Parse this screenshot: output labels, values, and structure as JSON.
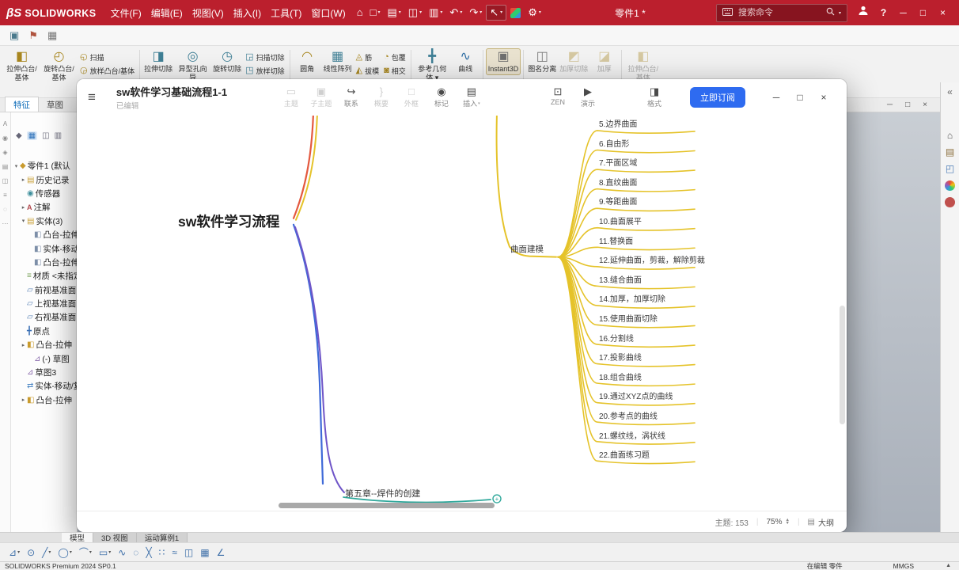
{
  "colors": {
    "solidworks_red": "#bb1f2d",
    "xmind_blue": "#2e6bf0"
  },
  "solidworks": {
    "titlebar": {
      "logo": "SOLIDWORKS",
      "menus": [
        "文件(F)",
        "编辑(E)",
        "视图(V)",
        "插入(I)",
        "工具(T)",
        "窗口(W)"
      ],
      "tools": [
        {
          "name": "home-icon",
          "glyph": "⌂"
        },
        {
          "name": "new-file-icon",
          "glyph": "□",
          "caret": true
        },
        {
          "name": "open-file-icon",
          "glyph": "▤",
          "caret": true
        },
        {
          "name": "save-icon",
          "glyph": "◫",
          "caret": true
        },
        {
          "name": "print-icon",
          "glyph": "▥",
          "caret": true
        },
        {
          "name": "undo-icon",
          "glyph": "↶",
          "caret": true
        },
        {
          "name": "redo-icon",
          "glyph": "↷",
          "caret": true
        },
        {
          "name": "select-cursor-icon",
          "glyph": "↖",
          "caret": true,
          "boxed": true
        },
        {
          "name": "xpress-products-icon",
          "cube": true
        },
        {
          "name": "options-icon",
          "glyph": "⚙",
          "caret": true
        }
      ],
      "doc_title": "零件1 *",
      "search_placeholder": "搜索命令"
    },
    "quickbar": [
      {
        "name": "capture-icon",
        "glyph": "▣",
        "color": "#49798c"
      },
      {
        "name": "flag-icon",
        "glyph": "⚑",
        "color": "#b0543f"
      },
      {
        "name": "grid-icon",
        "glyph": "▦",
        "color": "#767676"
      }
    ],
    "ribbon": [
      {
        "t": "big",
        "id": "extruded-boss",
        "label": "拉伸凸台/基体",
        "glyph": "◧"
      },
      {
        "t": "big",
        "id": "revolved-boss",
        "label": "旋转凸台/基体",
        "glyph": "◴"
      },
      {
        "t": "col",
        "items": [
          {
            "id": "swept-boss",
            "label": "扫描",
            "glyph": "◵"
          },
          {
            "id": "lofted-boss",
            "label": "放样凸台/基体",
            "glyph": "◶"
          }
        ]
      },
      {
        "t": "sep"
      },
      {
        "t": "big",
        "id": "extruded-cut",
        "label": "拉伸切除",
        "glyph": "◨",
        "c": "#3f7f95"
      },
      {
        "t": "big",
        "id": "hole-wizard",
        "label": "异型孔向导",
        "glyph": "◎",
        "c": "#3f7f95"
      },
      {
        "t": "big",
        "id": "revolved-cut",
        "label": "旋转切除",
        "glyph": "◷",
        "c": "#3f7f95"
      },
      {
        "t": "col",
        "items": [
          {
            "id": "swept-cut",
            "label": "扫描切除",
            "glyph": "◲",
            "c": "#3f7f95"
          },
          {
            "id": "lofted-cut",
            "label": "放样切除",
            "glyph": "◳",
            "c": "#3f7f95"
          }
        ]
      },
      {
        "t": "sep"
      },
      {
        "t": "big",
        "id": "fillet",
        "label": "圆角",
        "glyph": "◠"
      },
      {
        "t": "big",
        "id": "linear-pattern",
        "label": "线性阵列",
        "glyph": "▦",
        "c": "#3f7f95"
      },
      {
        "t": "col",
        "items": [
          {
            "id": "rib",
            "label": "筋",
            "glyph": "◬"
          },
          {
            "id": "draft",
            "label": "拔模",
            "glyph": "◭"
          }
        ]
      },
      {
        "t": "col",
        "items": [
          {
            "id": "wrap",
            "label": "包覆",
            "glyph": "◔"
          },
          {
            "id": "intersect",
            "label": "相交",
            "glyph": "◙"
          }
        ]
      },
      {
        "t": "sep"
      },
      {
        "t": "big",
        "id": "reference-geometry",
        "label": "参考几何体",
        "glyph": "╋",
        "c": "#3f7f95",
        "caret": true
      },
      {
        "t": "big",
        "id": "curves",
        "label": "曲线",
        "glyph": "∿",
        "c": "#2e6da3"
      },
      {
        "t": "sep"
      },
      {
        "t": "big",
        "id": "instant3d",
        "label": "Instant3D",
        "glyph": "▣",
        "c": "#6f6f6f",
        "active": true
      },
      {
        "t": "sep"
      },
      {
        "t": "big",
        "id": "detach",
        "label": "图名分离",
        "glyph": "◫",
        "c": "#7a7a7a"
      },
      {
        "t": "big",
        "id": "thicken-cut",
        "label": "加厚切除",
        "glyph": "◩",
        "disabled": true
      },
      {
        "t": "big",
        "id": "thicken",
        "label": "加厚",
        "glyph": "◪",
        "disabled": true
      },
      {
        "t": "sep"
      },
      {
        "t": "big",
        "id": "extruded-boss-2",
        "label": "拉伸凸台/基体",
        "glyph": "◧",
        "disabled": true
      }
    ],
    "cmd_tabs": [
      {
        "label": "特征",
        "active": true
      },
      {
        "label": "草图"
      }
    ],
    "left_strip_icons": [
      {
        "name": "annotation-a-icon",
        "glyph": "A"
      },
      {
        "name": "eye-icon",
        "glyph": "◉"
      },
      {
        "name": "diamond-icon",
        "glyph": "◈"
      },
      {
        "name": "layers-icon",
        "glyph": "▤"
      },
      {
        "name": "panel-icon",
        "glyph": "◫"
      },
      {
        "name": "list-icon",
        "glyph": "≡"
      },
      {
        "name": "circle-icon",
        "glyph": "◌"
      },
      {
        "name": "dots-icon",
        "glyph": "⋯"
      }
    ],
    "tree": {
      "toolbar": [
        {
          "name": "featuremanager-tab-icon",
          "glyph": "◆"
        },
        {
          "name": "propertymanager-tab-icon",
          "glyph": "▦",
          "active": true
        },
        {
          "name": "configuration-tab-icon",
          "glyph": "◫"
        },
        {
          "name": "display-tab-icon",
          "glyph": "▥"
        }
      ],
      "rows": [
        {
          "id": "part",
          "d": 0,
          "exp": "▾",
          "icon": "part",
          "label": "零件1 (默认"
        },
        {
          "id": "history",
          "d": 1,
          "exp": "▸",
          "icon": "folder",
          "label": "历史记录"
        },
        {
          "id": "sensors",
          "d": 1,
          "icon": "sensor",
          "label": "传感器"
        },
        {
          "id": "annotations",
          "d": 1,
          "exp": "▸",
          "icon": "ann",
          "label": "注解"
        },
        {
          "id": "solid-bodies",
          "d": 1,
          "exp": "▾",
          "icon": "folder",
          "label": "实体(3)"
        },
        {
          "id": "body-1",
          "d": 2,
          "icon": "body",
          "label": "凸台-拉伸"
        },
        {
          "id": "body-2",
          "d": 2,
          "icon": "body",
          "label": "实体-移动"
        },
        {
          "id": "body-3",
          "d": 2,
          "icon": "body",
          "label": "凸台-拉伸"
        },
        {
          "id": "material",
          "d": 1,
          "icon": "mat",
          "label": "材质 <未指定>"
        },
        {
          "id": "front-plane",
          "d": 1,
          "icon": "plane",
          "label": "前视基准面"
        },
        {
          "id": "top-plane",
          "d": 1,
          "icon": "plane",
          "label": "上视基准面"
        },
        {
          "id": "right-plane",
          "d": 1,
          "icon": "plane",
          "label": "右视基准面"
        },
        {
          "id": "origin",
          "d": 1,
          "icon": "origin",
          "label": "原点"
        },
        {
          "id": "boss-extrude-1",
          "d": 1,
          "exp": "▸",
          "icon": "boss",
          "label": "凸台-拉伸"
        },
        {
          "id": "sketch-2",
          "d": 2,
          "icon": "sketch",
          "label": "(-) 草图"
        },
        {
          "id": "sketch-3",
          "d": 1,
          "icon": "sketch",
          "label": "草图3"
        },
        {
          "id": "body-move-copy",
          "d": 1,
          "icon": "move",
          "label": "实体-移动/复制"
        },
        {
          "id": "boss-extrude-2",
          "d": 1,
          "exp": "▸",
          "icon": "boss",
          "label": "凸台-拉伸"
        }
      ]
    },
    "task_pane": [
      {
        "name": "collapse-chevron-icon",
        "glyph": "«",
        "color": "#666666"
      },
      {
        "name": "resources-home-icon",
        "glyph": "⌂",
        "color": "#555555",
        "gap": 34
      },
      {
        "name": "design-library-icon",
        "glyph": "▤",
        "color": "#8a6d3b"
      },
      {
        "name": "file-explorer-icon",
        "glyph": "◰",
        "color": "#4a7ab5"
      },
      {
        "name": "appearances-icon",
        "circle": "conic"
      },
      {
        "name": "scenes-icon",
        "circle": "#c0504d"
      }
    ],
    "bottom_tabs": [
      {
        "label": "模型",
        "active": true
      },
      {
        "label": "3D 视图"
      },
      {
        "label": "运动算例1"
      }
    ],
    "sketch_tools": [
      {
        "name": "sketch-icon",
        "glyph": "⊿",
        "caret": true
      },
      {
        "name": "smart-dimension-icon",
        "glyph": "⊙"
      },
      {
        "name": "line-icon",
        "glyph": "╱",
        "caret": true
      },
      {
        "name": "circle-icon",
        "glyph": "◯",
        "caret": true
      },
      {
        "name": "arc-icon",
        "glyph": "⌒",
        "caret": true
      },
      {
        "name": "rectangle-icon",
        "glyph": "▭",
        "caret": true
      },
      {
        "name": "spline-icon",
        "glyph": "∿"
      },
      {
        "name": "ellipse-icon",
        "glyph": "◌"
      },
      {
        "name": "trim-icon",
        "glyph": "╳"
      },
      {
        "name": "convert-entities-icon",
        "glyph": "∷"
      },
      {
        "name": "offset-icon",
        "glyph": "≈"
      },
      {
        "name": "mirror-icon",
        "glyph": "◫"
      },
      {
        "name": "pattern-icon",
        "glyph": "▦"
      },
      {
        "name": "angle-icon",
        "glyph": "∠"
      }
    ],
    "statusbar": {
      "left": "SOLIDWORKS Premium 2024 SP0.1",
      "editing": "在编辑 零件",
      "units": "MMGS"
    }
  },
  "xmind": {
    "title": "sw软件学习基础流程1-1",
    "subtitle": "已编辑",
    "tools": [
      {
        "id": "topic",
        "label": "主题",
        "icon": "▭",
        "disabled": true
      },
      {
        "id": "subtopic",
        "label": "子主题",
        "icon": "▣",
        "disabled": true
      },
      {
        "id": "relationship",
        "label": "联系",
        "icon": "↪"
      },
      {
        "id": "summary",
        "label": "概要",
        "icon": "}",
        "disabled": true
      },
      {
        "id": "boundary",
        "label": "外框",
        "icon": "□",
        "disabled": true
      },
      {
        "id": "marker",
        "label": "标记",
        "icon": "◉"
      },
      {
        "id": "insert",
        "label": "插入",
        "icon": "▤",
        "caret": true
      }
    ],
    "right_tools": [
      {
        "id": "zen",
        "label": "ZEN",
        "icon": "⊡"
      },
      {
        "id": "present",
        "label": "演示",
        "icon": "▶"
      },
      {
        "id": "format",
        "label": "格式",
        "icon": "◨"
      }
    ],
    "subscribe_label": "立即订阅",
    "window_controls": [
      "─",
      "□",
      "×"
    ],
    "status": {
      "topics": "主题: 153",
      "zoom": "75%",
      "outline": "大纲"
    }
  },
  "mindmap": {
    "central": "sw软件学习流程",
    "branch_parent": "曲面建模",
    "items": [
      "5.边界曲面",
      "6.自由形",
      "7.平面区域",
      "8.直纹曲面",
      "9.等距曲面",
      "10.曲面展平",
      "11.替换面",
      "12.延伸曲面，剪裁，解除剪裁",
      "13.缝合曲面",
      "14.加厚，加厚切除",
      "15.使用曲面切除",
      "16.分割线",
      "17.投影曲线",
      "18.组合曲线",
      "19.通过XYZ点的曲线",
      "20.参考点的曲线",
      "21.螺纹线，涡状线",
      "22.曲面练习题"
    ],
    "bottom_node": "第五章--焊件的创建",
    "colors": {
      "yellow": "#e5c32a",
      "red": "#e4593f",
      "blue": "#3f6ad8",
      "purple": "#6f55c8",
      "teal": "#2fa89b"
    }
  },
  "icon_glyphs": {
    "tree": {
      "part": "◆",
      "folder": "▤",
      "sensor": "◉",
      "ann": "A",
      "body": "◧",
      "mat": "≡",
      "plane": "▱",
      "origin": "╋",
      "boss": "◧",
      "sketch": "⊿",
      "move": "⇄"
    }
  }
}
